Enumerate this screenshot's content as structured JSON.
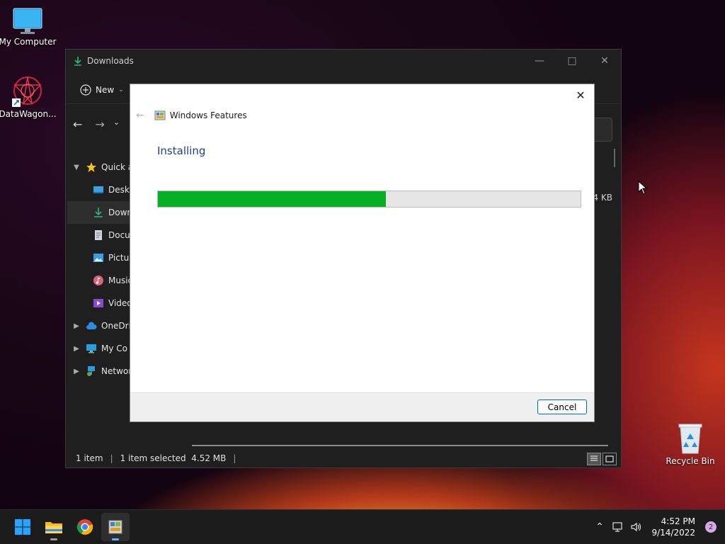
{
  "desktop": {
    "icons": [
      {
        "label": "My Computer"
      },
      {
        "label": "DataWagon..."
      },
      {
        "label": "Recycle Bin"
      }
    ]
  },
  "explorer": {
    "title": "Downloads",
    "toolbar": {
      "new_label": "New"
    },
    "sidebar": [
      {
        "label": "Quick access",
        "display": "Quick a"
      },
      {
        "label": "Desktop",
        "display": "Deskto"
      },
      {
        "label": "Downloads",
        "display": "Down"
      },
      {
        "label": "Documents",
        "display": "Docu"
      },
      {
        "label": "Pictures",
        "display": "Pictur"
      },
      {
        "label": "Music",
        "display": "Music"
      },
      {
        "label": "Videos",
        "display": "Video:"
      },
      {
        "label": "OneDrive",
        "display": "OneDriv"
      },
      {
        "label": "My Computer",
        "display": "My Co"
      },
      {
        "label": "Network",
        "display": "Networ"
      }
    ],
    "file_size_partial": "4 KB",
    "status": {
      "item_count": "1 item",
      "selection": "1 item selected  4.52 MB"
    }
  },
  "dialog": {
    "app_title": "Windows Features",
    "heading": "Installing",
    "progress": 0.54,
    "cancel_label": "Cancel"
  },
  "taskbar": {
    "time": "4:52 PM",
    "date": "9/14/2022",
    "notification_count": "2"
  },
  "colors": {
    "progress_fill": "#06b025",
    "heading_blue": "#1e3f8c",
    "accent": "#0067c0"
  }
}
